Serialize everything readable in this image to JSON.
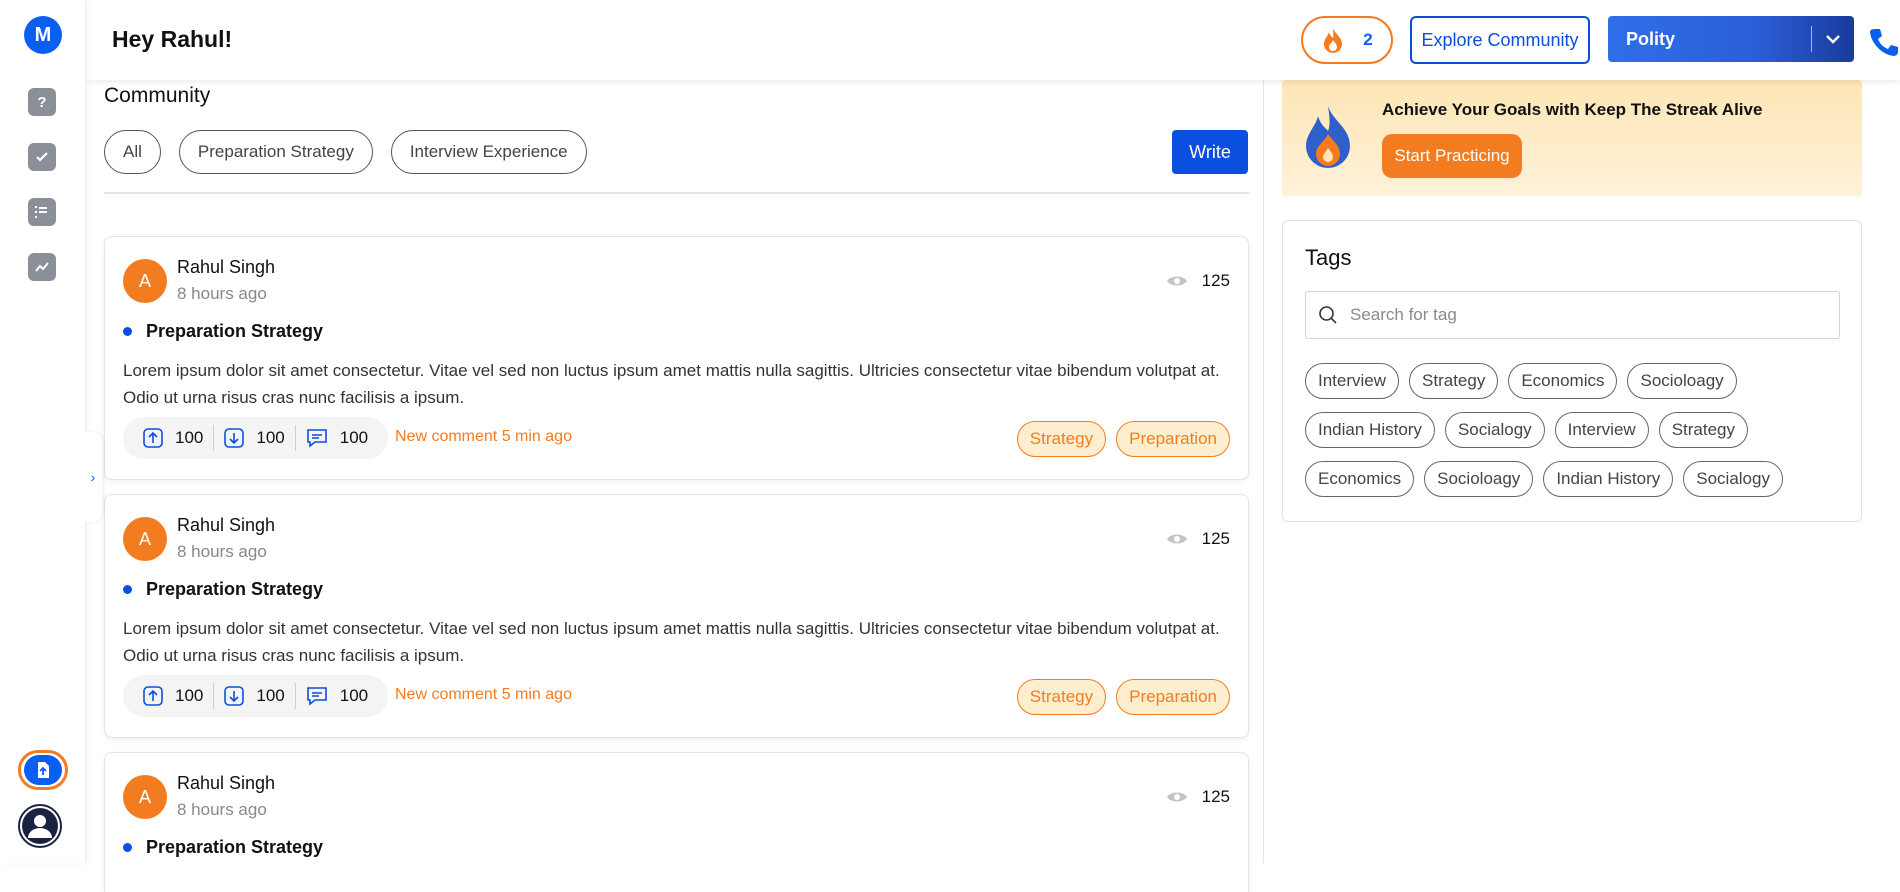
{
  "app": {
    "logo_letter": "M"
  },
  "header": {
    "greeting": "Hey Rahul!",
    "streak_count": "2",
    "explore_label": "Explore Community",
    "subject_selected": "Polity"
  },
  "community": {
    "title": "Community",
    "filters": [
      "All",
      "Preparation Strategy",
      "Interview Experience"
    ],
    "write_label": "Write"
  },
  "posts": [
    {
      "avatar_letter": "A",
      "author": "Rahul Singh",
      "time": "8 hours ago",
      "views": "125",
      "category": "Preparation Strategy",
      "body": "Lorem ipsum dolor sit amet consectetur. Vitae vel sed non luctus ipsum amet mattis nulla sagittis. Ultricies consectetur vitae bibendum volutpat at. Odio ut urna risus cras nunc facilisis a ipsum.",
      "upvotes": "100",
      "downvotes": "100",
      "comments": "100",
      "new_comment": "New comment 5 min ago",
      "tags": [
        "Strategy",
        "Preparation"
      ]
    },
    {
      "avatar_letter": "A",
      "author": "Rahul Singh",
      "time": "8 hours ago",
      "views": "125",
      "category": "Preparation Strategy",
      "body": "Lorem ipsum dolor sit amet consectetur. Vitae vel sed non luctus ipsum amet mattis nulla sagittis. Ultricies consectetur vitae bibendum volutpat at. Odio ut urna risus cras nunc facilisis a ipsum.",
      "upvotes": "100",
      "downvotes": "100",
      "comments": "100",
      "new_comment": "New comment 5 min ago",
      "tags": [
        "Strategy",
        "Preparation"
      ]
    },
    {
      "avatar_letter": "A",
      "author": "Rahul Singh",
      "time": "8 hours ago",
      "views": "125",
      "category": "Preparation Strategy"
    }
  ],
  "streak_card": {
    "title": "Achieve Your Goals with Keep The Streak Alive",
    "cta": "Start Practicing"
  },
  "tags_panel": {
    "title": "Tags",
    "search_placeholder": "Search for tag",
    "tags": [
      "Interview",
      "Strategy",
      "Economics",
      "Socioloagy",
      "Indian History",
      "Socialogy",
      "Interview",
      "Strategy",
      "Economics",
      "Socioloagy",
      "Indian History",
      "Socialogy"
    ]
  },
  "colors": {
    "brand_blue": "#0b4fe0",
    "accent_orange": "#f47c20"
  }
}
